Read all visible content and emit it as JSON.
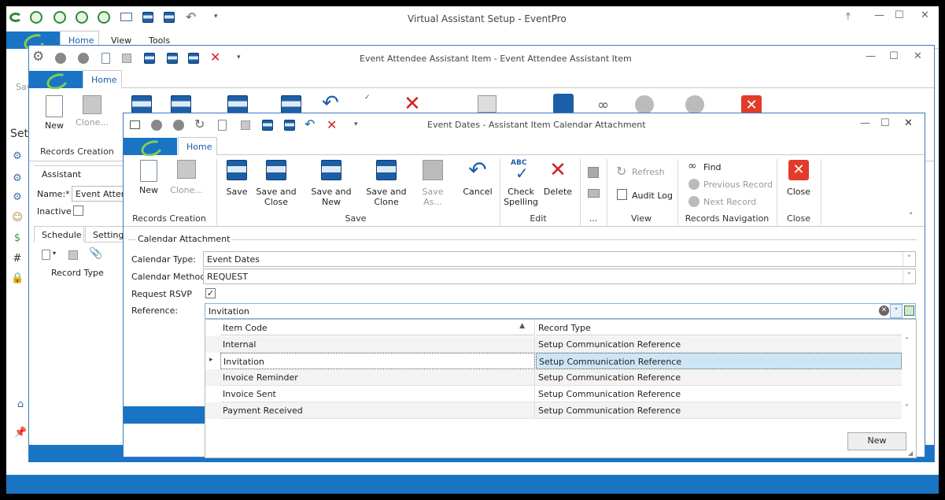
{
  "main_window": {
    "title": "Virtual Assistant Setup - EventPro",
    "tabs": [
      "Home",
      "View",
      "Tools"
    ],
    "side_label_save": "Sav",
    "side_label_setup": "Setu"
  },
  "attendee_window": {
    "title": "Event Attendee Assistant Item - Event Attendee Assistant Item",
    "tab_home": "Home",
    "new_label": "New",
    "clone_label": "Clone...",
    "records_creation_label": "Records Creation",
    "assistant_section": "Assistant",
    "name_label": "Name:*",
    "name_value": "Event Attend",
    "inactive_label": "Inactive",
    "sub_tabs": [
      "Schedule",
      "Settings"
    ],
    "record_type_header": "Record Type"
  },
  "dialog": {
    "title": "Event Dates - Assistant Item Calendar Attachment",
    "tab_home": "Home",
    "ribbon": {
      "new": "New",
      "clone": "Clone...",
      "save": "Save",
      "save_close_1": "Save and",
      "save_close_2": "Close",
      "save_new": "Save and New",
      "save_clone_1": "Save and",
      "save_clone_2": "Clone",
      "save_as": "Save As...",
      "cancel": "Cancel",
      "check_spelling_1": "Check",
      "check_spelling_2": "Spelling",
      "delete": "Delete",
      "refresh": "Refresh",
      "audit_log": "Audit Log",
      "find": "Find",
      "previous_record": "Previous Record",
      "next_record": "Next Record",
      "close": "Close",
      "abc": "ABC"
    },
    "groups": {
      "records_creation": "Records Creation",
      "save": "Save",
      "edit": "Edit",
      "more": "...",
      "view": "View",
      "records_navigation": "Records Navigation",
      "close": "Close"
    },
    "section_title": "Calendar Attachment",
    "fields": {
      "calendar_type_label": "Calendar Type:",
      "calendar_type_value": "Event Dates",
      "calendar_method_label": "Calendar Method:",
      "calendar_method_value": "REQUEST",
      "request_rsvp_label": "Request RSVP",
      "request_rsvp_checked": true,
      "reference_label": "Reference:",
      "reference_value": "Invitation"
    },
    "dropdown": {
      "columns": [
        "Item Code",
        "Record Type"
      ],
      "rows": [
        {
          "code": "Internal",
          "type": "Setup Communication Reference"
        },
        {
          "code": "Invitation",
          "type": "Setup Communication Reference"
        },
        {
          "code": "Invoice Reminder",
          "type": "Setup Communication Reference"
        },
        {
          "code": "Invoice Sent",
          "type": "Setup Communication Reference"
        },
        {
          "code": "Payment Received",
          "type": "Setup Communication Reference"
        }
      ],
      "selected_index": 1,
      "new_button": "New"
    }
  },
  "colors": {
    "accent": "#1a74c4",
    "selection": "#cde6f7"
  }
}
